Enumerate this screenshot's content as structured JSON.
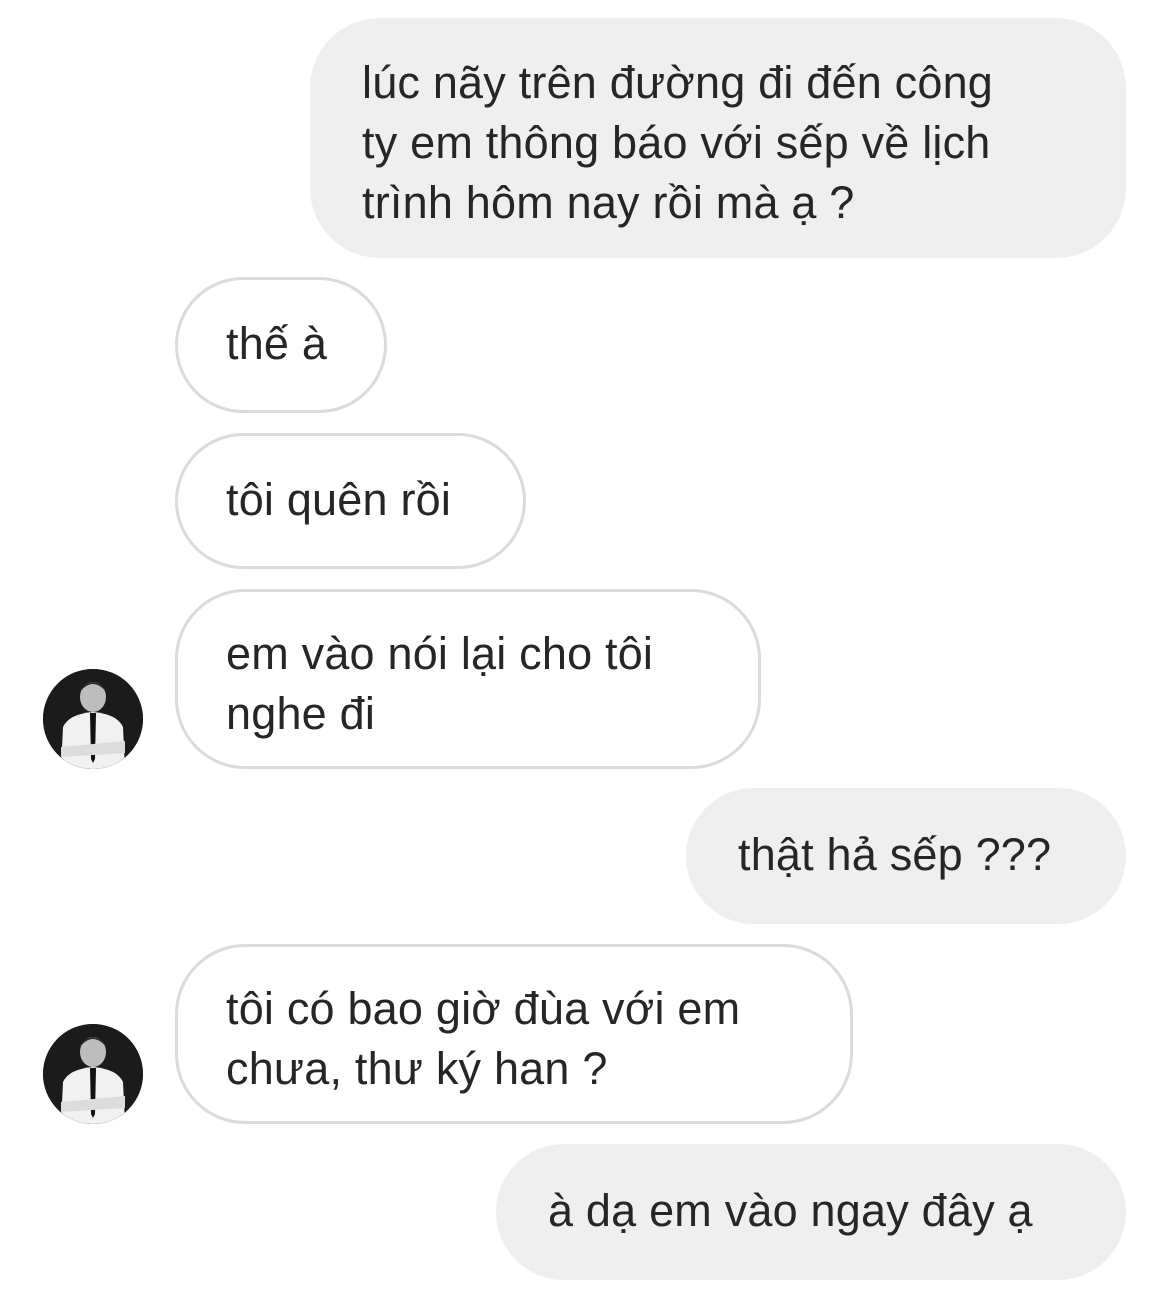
{
  "messages": [
    {
      "sender": "me",
      "text": "lúc nãy trên đường đi đến công\nty em thông báo với sếp về lịch\ntrình hôm nay rồi mà ạ ?"
    },
    {
      "sender": "them",
      "text": "thế à"
    },
    {
      "sender": "them",
      "text": "tôi quên rồi"
    },
    {
      "sender": "them",
      "text": "em vào nói lại cho tôi\nnghe đi",
      "avatar": true
    },
    {
      "sender": "me",
      "text": "thật hả sếp ???"
    },
    {
      "sender": "them",
      "text": "tôi có bao giờ đùa với em\nchưa, thư ký han ?",
      "avatar": true
    },
    {
      "sender": "me",
      "text": "à dạ em vào ngay đây ạ"
    }
  ],
  "colors": {
    "sent_bubble_bg": "#efefef",
    "recv_bubble_border": "#dbdbdb",
    "text": "#262626"
  },
  "icons": {
    "avatar": "contact-profile-photo"
  }
}
